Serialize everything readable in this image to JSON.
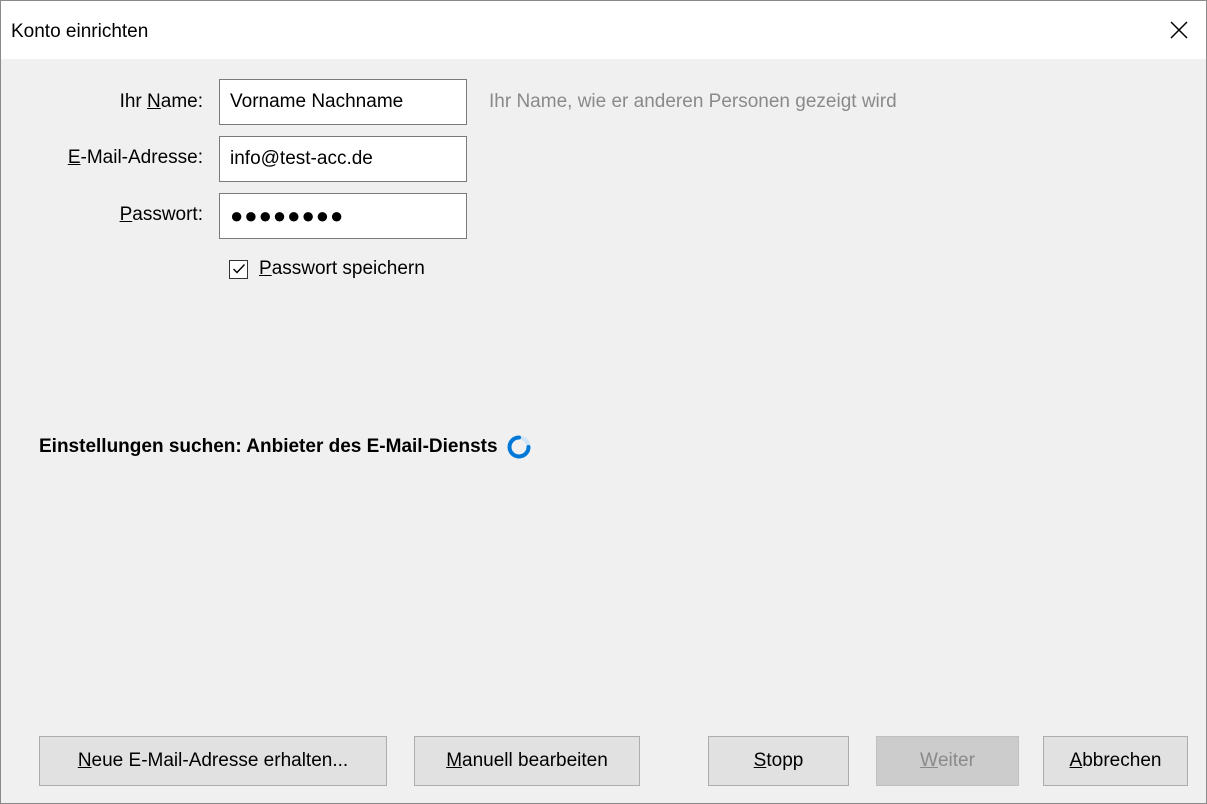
{
  "window": {
    "title": "Konto einrichten"
  },
  "form": {
    "name_label_pre": "Ihr ",
    "name_label_key": "N",
    "name_label_post": "ame:",
    "name_value": "Vorname Nachname",
    "name_hint": "Ihr Name, wie er anderen Personen gezeigt wird",
    "email_label_key": "E",
    "email_label_post": "-Mail-Adresse:",
    "email_value": "info@test-acc.de",
    "password_label_key": "P",
    "password_label_post": "asswort:",
    "password_value": "●●●●●●●●",
    "remember_key": "P",
    "remember_post": "asswort speichern",
    "remember_checked": true
  },
  "status": {
    "text": "Einstellungen suchen: Anbieter des E-Mail-Diensts",
    "accent": "#0078d7"
  },
  "buttons": {
    "new_address_key": "N",
    "new_address_post": "eue E-Mail-Adresse erhalten...",
    "manual_key": "M",
    "manual_post": "anuell bearbeiten",
    "stop_key": "S",
    "stop_post": "topp",
    "next_key": "W",
    "next_post": "eiter",
    "next_disabled": true,
    "cancel_key": "A",
    "cancel_post": "bbrechen"
  },
  "icons": {
    "close": "close-icon",
    "check": "checkmark-icon",
    "spinner": "loading-spinner-icon"
  }
}
